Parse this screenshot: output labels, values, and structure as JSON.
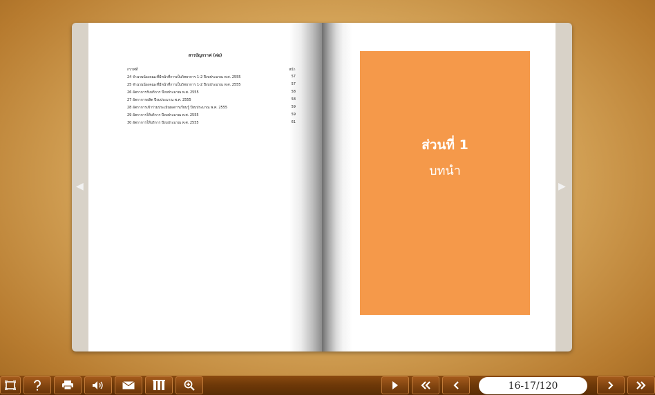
{
  "toc": {
    "title": "สารบัญกราฟ (ต่อ)",
    "head_left": "กราฟที่",
    "head_right": "หน้า",
    "rows": [
      {
        "text": "24 จำนวนน้องคณะที่มีหน้าที่การเป็นวิทยาการ 1-2 ปีงบประมาณ พ.ศ. 2555",
        "page": "57"
      },
      {
        "text": "25 จำนวนน้องคณะที่มีหน้าที่การเป็นวิทยาการ 1-2 ปีงบประมาณ พ.ศ. 2555",
        "page": "57"
      },
      {
        "text": "26 อัตราการรับบริการ ปีงบประมาณ พ.ศ. 2555",
        "page": "58"
      },
      {
        "text": "27 อัตราการผลิต ปีงบประมาณ พ.ศ. 2555",
        "page": "58"
      },
      {
        "text": "28 อัตราการเข้าร่วมประเมินผลการเรียนรู้ ปีงบประมาณ พ.ศ. 2555",
        "page": "59"
      },
      {
        "text": "29 อัตราการให้บริการ ปีงบประมาณ พ.ศ. 2555",
        "page": "59"
      },
      {
        "text": "30 อัตราการให้บริการ ปีงบประมาณ พ.ศ. 2555",
        "page": "61"
      }
    ]
  },
  "right_page": {
    "part_title": "ส่วนที่ 1",
    "part_subtitle": "บทนำ"
  },
  "nav": {
    "prev_arrow": "◀",
    "next_arrow": "▶"
  },
  "toolbar": {
    "page_indicator": "16-17/120"
  },
  "colors": {
    "accent_orange": "#f5994a",
    "toolbar_brown": "#6d3808"
  }
}
